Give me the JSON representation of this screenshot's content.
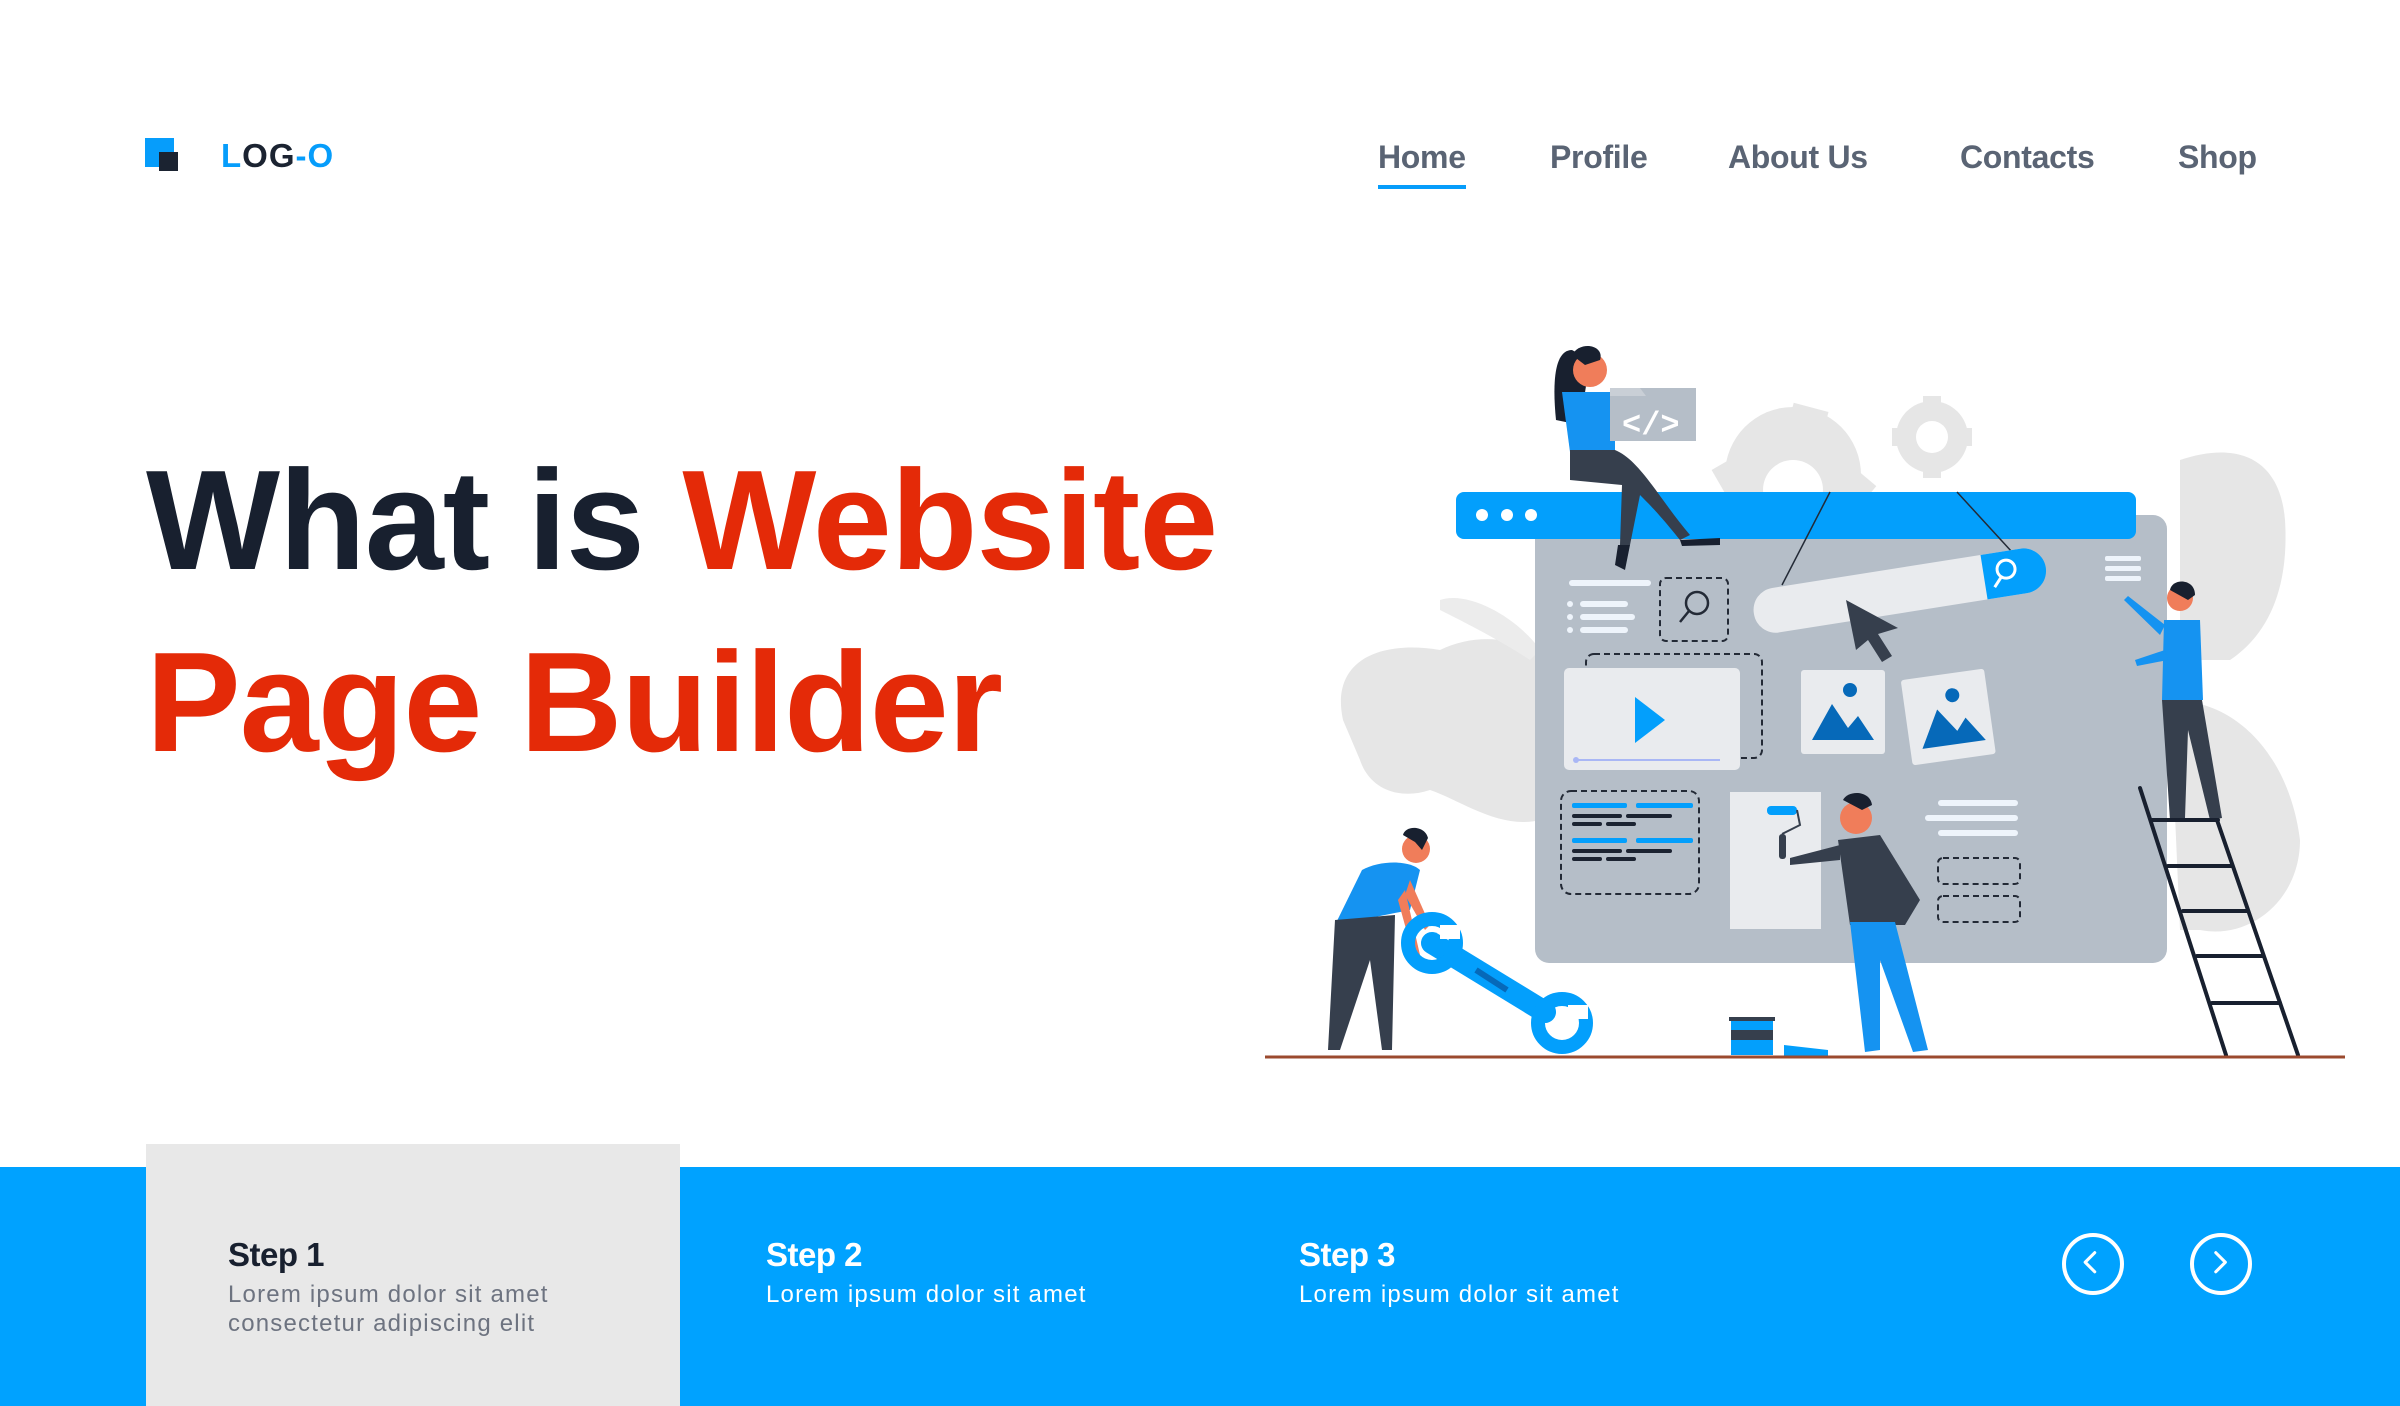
{
  "brand": {
    "logo_text_parts": [
      "L",
      "OG",
      "-O"
    ],
    "logo_icon": "two-overlapping-squares-icon",
    "colors": {
      "primary": "#069dfb",
      "dark": "#1b2331",
      "accent_red": "#e42a08",
      "band_blue": "#00a2ff",
      "nav_text": "#5a6474"
    }
  },
  "nav": {
    "items": [
      {
        "label": "Home",
        "active": true
      },
      {
        "label": "Profile",
        "active": false
      },
      {
        "label": "About Us",
        "active": false
      },
      {
        "label": "Contacts",
        "active": false
      },
      {
        "label": "Shop",
        "active": false
      }
    ]
  },
  "hero": {
    "headline_part1": "What is ",
    "headline_part2": "Website",
    "headline_line2": "Page Builder"
  },
  "illustration": {
    "description": "Team building a website page: browser window with search bar, video player, image placeholders and text blocks; people holding code icon, wrench, paint roller, and standing on ladder",
    "code_icon_label": "</>",
    "icons": [
      "code-icon",
      "search-icon",
      "cursor-icon",
      "play-icon",
      "image-icon",
      "menu-icon",
      "gear-icon",
      "wrench-icon",
      "paint-roller-icon",
      "ladder-icon",
      "paint-bucket-icon"
    ]
  },
  "steps": [
    {
      "title": "Step 1",
      "description": "Lorem ipsum dolor sit amet consectetur adipiscing elit",
      "active": true
    },
    {
      "title": "Step 2",
      "description": "Lorem ipsum dolor sit amet",
      "active": false
    },
    {
      "title": "Step 3",
      "description": "Lorem ipsum dolor sit amet",
      "active": false
    }
  ],
  "carousel": {
    "prev_icon": "chevron-left-icon",
    "next_icon": "chevron-right-icon"
  }
}
